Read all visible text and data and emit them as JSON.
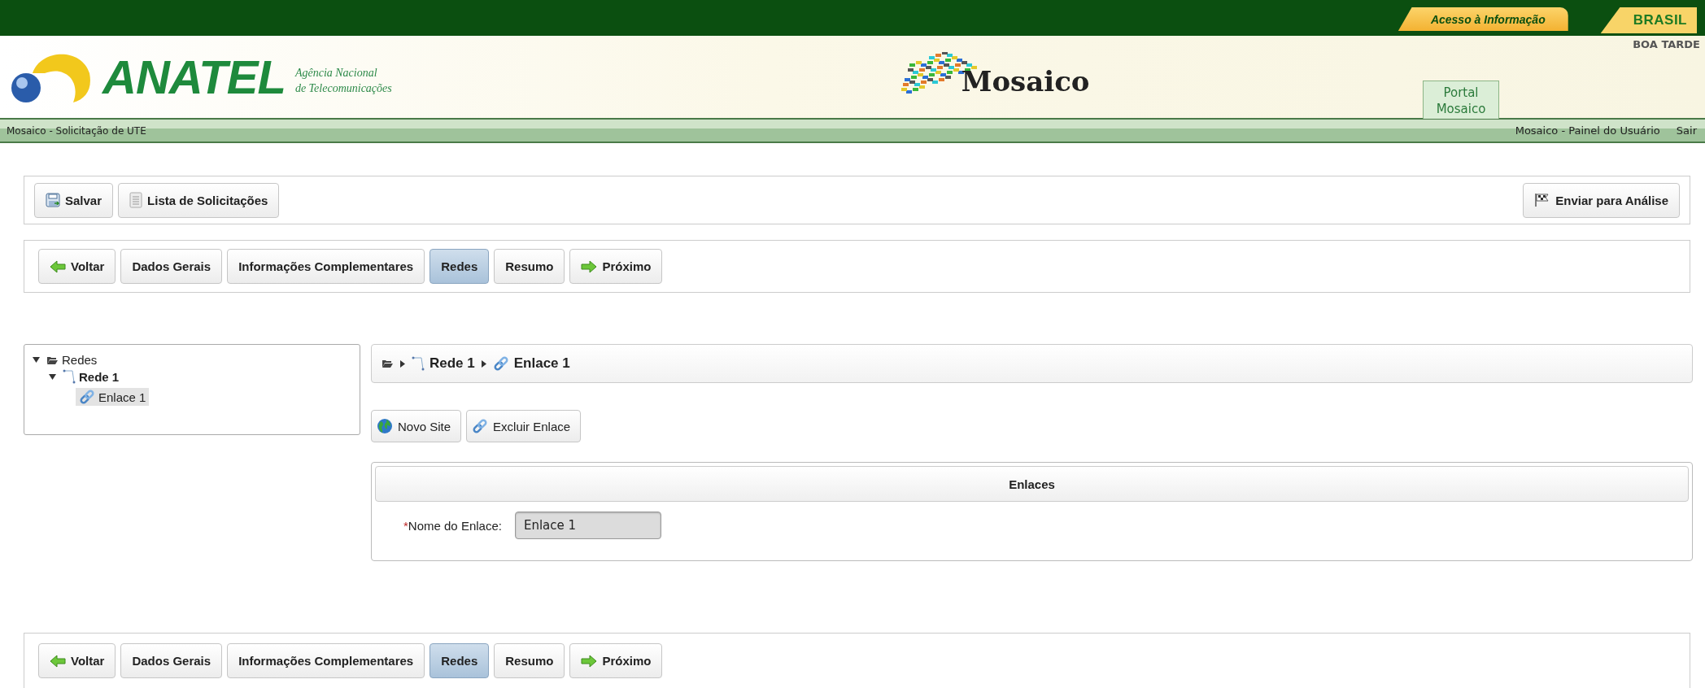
{
  "top_bar": {
    "access_link": "Acesso à Informação",
    "brasil_link": "BRASIL"
  },
  "header": {
    "logo_text": "ANATEL",
    "agency_line1": "Agência Nacional",
    "agency_line2": "de Telecomunicações",
    "app_logo_text": "Mosaico",
    "greeting": "BOA TARDE",
    "portal_tab": "Portal Mosaico"
  },
  "subnav": {
    "title": "Mosaico - Solicitação de UTE",
    "links": [
      "Mosaico - Painel do Usuário",
      "Sair"
    ]
  },
  "toolbar": {
    "left_buttons": [
      {
        "label": "Salvar",
        "kind": "save"
      },
      {
        "label": "Lista de Solicitações",
        "kind": "list"
      }
    ],
    "right_buttons": [
      {
        "label": "Enviar para Análise",
        "kind": "flag"
      }
    ]
  },
  "steps_top": [
    {
      "label": "Voltar",
      "kind": "back",
      "selected": false
    },
    {
      "label": "Dados Gerais",
      "kind": "step",
      "selected": false
    },
    {
      "label": "Informações Complementares",
      "kind": "step",
      "selected": false
    },
    {
      "label": "Redes",
      "kind": "step",
      "selected": true
    },
    {
      "label": "Resumo",
      "kind": "step",
      "selected": false
    },
    {
      "label": "Próximo",
      "kind": "next",
      "selected": false
    }
  ],
  "tree": [
    {
      "label": "Redes",
      "kind": "folder",
      "expanded": true,
      "selected": false,
      "children": [
        {
          "label": "Rede 1",
          "kind": "network",
          "expanded": true,
          "selected": false,
          "children": [
            {
              "label": "Enlace 1",
              "kind": "link",
              "selected": true
            }
          ]
        }
      ]
    }
  ],
  "breadcrumb": [
    {
      "kind": "folder"
    },
    {
      "label": "Rede 1",
      "kind": "network"
    },
    {
      "label": "Enlace 1",
      "kind": "link"
    }
  ],
  "actions": [
    {
      "label": "Novo Site",
      "kind": "globe"
    },
    {
      "label": "Excluir Enlace",
      "kind": "link"
    }
  ],
  "form": {
    "title": "Enlaces",
    "fields": [
      {
        "label": "Nome do Enlace:",
        "required_mark": "*",
        "value": "Enlace 1",
        "disabled": true
      }
    ]
  },
  "steps_bottom": [
    {
      "label": "Voltar",
      "kind": "back",
      "selected": false
    },
    {
      "label": "Dados Gerais",
      "kind": "step",
      "selected": false
    },
    {
      "label": "Informações Complementares",
      "kind": "step",
      "selected": false
    },
    {
      "label": "Redes",
      "kind": "step",
      "selected": true
    },
    {
      "label": "Resumo",
      "kind": "step",
      "selected": false
    },
    {
      "label": "Próximo",
      "kind": "next",
      "selected": false
    }
  ]
}
